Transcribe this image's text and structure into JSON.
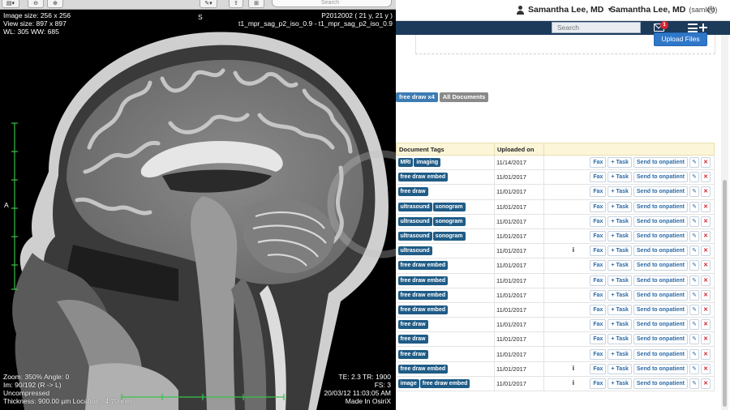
{
  "app": {
    "user_menu_1": {
      "name": "Samantha Lee, MD"
    },
    "user_menu_2": {
      "name": "Samantha Lee, MD",
      "username": "(samlee)"
    },
    "search_placeholder": "Search",
    "mail_badge_count": "1",
    "upload_button": "Upload Files",
    "filters": {
      "free_draw": "free draw x4",
      "all_documents": "All Documents"
    },
    "table": {
      "headers": {
        "tags": "Document Tags",
        "uploaded": "Uploaded on"
      },
      "action_labels": {
        "fax": "Fax",
        "task": "+ Task",
        "send": "Send to onpatient"
      },
      "rows": [
        {
          "tags": [
            "MRI",
            "imaging"
          ],
          "date": "11/14/2017",
          "info": false
        },
        {
          "tags": [
            "free draw embed"
          ],
          "date": "11/01/2017",
          "info": false
        },
        {
          "tags": [
            "free draw"
          ],
          "date": "11/01/2017",
          "info": false
        },
        {
          "tags": [
            "ultrasound",
            "sonogram"
          ],
          "date": "11/01/2017",
          "info": false
        },
        {
          "tags": [
            "ultrasound",
            "sonogram"
          ],
          "date": "11/01/2017",
          "info": false
        },
        {
          "tags": [
            "ultrasound",
            "sonogram"
          ],
          "date": "11/01/2017",
          "info": false
        },
        {
          "tags": [
            "ultrasound"
          ],
          "date": "11/01/2017",
          "info": true
        },
        {
          "tags": [
            "free draw embed"
          ],
          "date": "11/01/2017",
          "info": false
        },
        {
          "tags": [
            "free draw embed"
          ],
          "date": "11/01/2017",
          "info": false
        },
        {
          "tags": [
            "free draw embed"
          ],
          "date": "11/01/2017",
          "info": false
        },
        {
          "tags": [
            "free draw embed"
          ],
          "date": "11/01/2017",
          "info": false
        },
        {
          "tags": [
            "free draw"
          ],
          "date": "11/01/2017",
          "info": false
        },
        {
          "tags": [
            "free draw"
          ],
          "date": "11/01/2017",
          "info": false
        },
        {
          "tags": [
            "free draw"
          ],
          "date": "11/01/2017",
          "info": false
        },
        {
          "tags": [
            "free draw embed"
          ],
          "date": "11/01/2017",
          "info": true
        },
        {
          "tags": [
            "image",
            "free draw embed"
          ],
          "date": "11/01/2017",
          "info": true
        }
      ]
    }
  },
  "viewer": {
    "toolbar_search_placeholder": "Search",
    "overlay": {
      "top_left": [
        "Image size: 256 x 256",
        "View size: 897 x 897",
        "WL: 305 WW: 685"
      ],
      "top_right": [
        "P2012002 ( 21 y, 21 y )",
        "t1_mpr_sag_p2_iso_0.9 - t1_mpr_sag_p2_iso_0.9"
      ],
      "bottom_left": [
        "Zoom: 350% Angle: 0",
        "Im: 90/192 (R -> L)",
        "Uncompressed",
        "Thickness: 900.00 µm Location: -4.70 mm"
      ],
      "bottom_right": [
        "TE: 2.3 TR: 1900",
        "FS: 3",
        "20/03/12 11:03:05 AM",
        "Made In OsiriX"
      ],
      "orientation_top": "S",
      "orientation_left": "A"
    }
  },
  "colors": {
    "navbar": "#1c3a5a",
    "tag": "#1f5c87",
    "upload": "#2f77c9",
    "delete": "#c9232d",
    "table_header": "#fcf5d8"
  }
}
